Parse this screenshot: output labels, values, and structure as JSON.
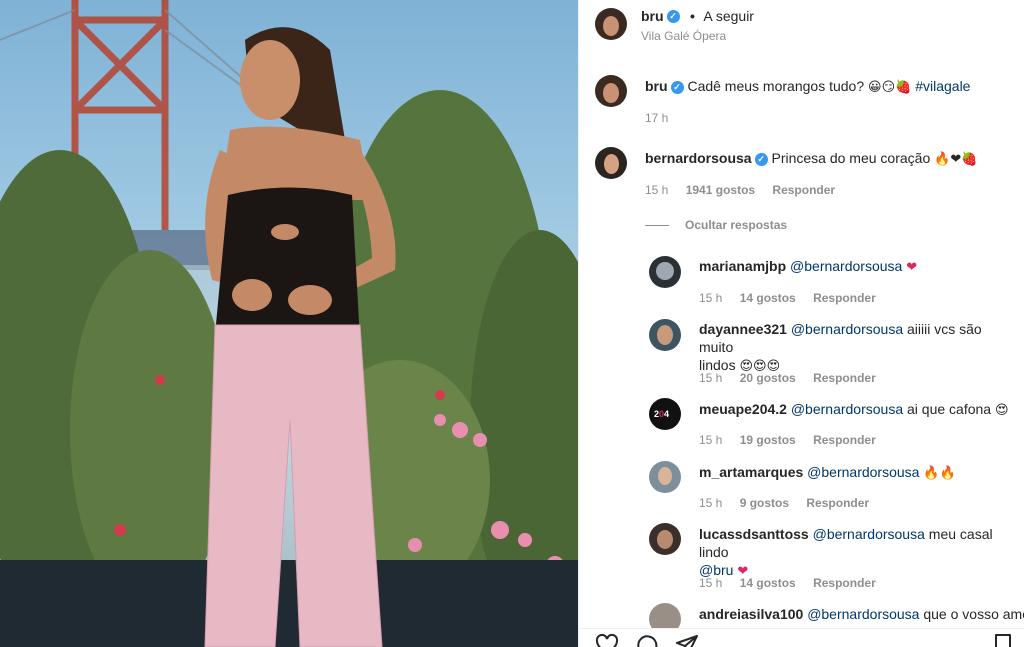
{
  "post": {
    "author": "bru",
    "follow_label": "A seguir",
    "separator": "•",
    "location": "Vila Galé Ópera"
  },
  "caption": {
    "author": "bru",
    "text": "Cadê meus morangos tudo?",
    "emojis": "😀😏🍓",
    "hashtag": "#vilagale",
    "time": "17 h"
  },
  "main_comment": {
    "author": "bernardorsousa",
    "text": "Princesa do meu coração",
    "emojis": "🔥❤🍓",
    "time": "15 h",
    "likes": "1941 gostos",
    "reply_label": "Responder"
  },
  "hide_replies_label": "Ocultar respostas",
  "replies": [
    {
      "author": "marianamjbp",
      "mention": "@bernardorsousa",
      "text": "",
      "text2": "",
      "emojis": "❤",
      "time": "15 h",
      "likes": "14 gostos",
      "reply_label": "Responder"
    },
    {
      "author": "dayannee321",
      "mention": "@bernardorsousa",
      "text": "aiiiii vcs são muito",
      "text2": "lindos",
      "emojis": "😍😍😍",
      "time": "15 h",
      "likes": "20 gostos",
      "reply_label": "Responder"
    },
    {
      "author": "meuape204.2",
      "mention": "@bernardorsousa",
      "text": "ai que cafona",
      "text2": "",
      "emojis": "😍",
      "time": "15 h",
      "likes": "19 gostos",
      "reply_label": "Responder"
    },
    {
      "author": "m_artamarques",
      "mention": "@bernardorsousa",
      "text": "",
      "text2": "",
      "emojis": "🔥🔥",
      "time": "15 h",
      "likes": "9 gostos",
      "reply_label": "Responder"
    },
    {
      "author": "lucassdsanttoss",
      "mention": "@bernardorsousa",
      "text": "meu casal lindo",
      "text2": "@bru",
      "emojis": "❤",
      "time": "15 h",
      "likes": "14 gostos",
      "reply_label": "Responder"
    },
    {
      "author": "andreiasilva100",
      "mention": "@bernardorsousa",
      "text": "que o vosso amor",
      "text2": "",
      "emojis": "",
      "time": "",
      "likes": "",
      "reply_label": ""
    }
  ],
  "icons": [
    "heart-icon",
    "comment-icon",
    "share-icon",
    "bookmark-icon",
    "verified-icon"
  ],
  "colors": {
    "verified": "#3897f0",
    "link": "#00376b",
    "muted": "#8e8e8e",
    "text": "#262626"
  }
}
